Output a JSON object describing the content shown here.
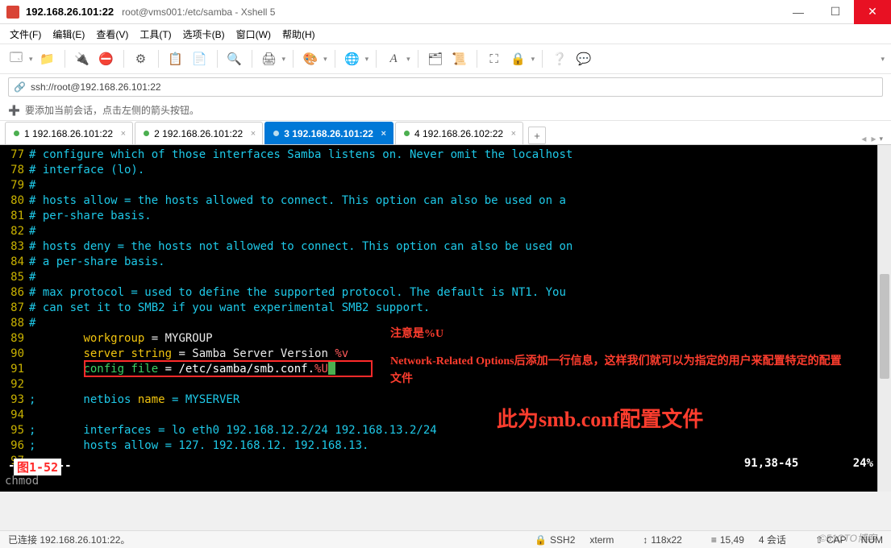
{
  "title": {
    "main": "192.168.26.101:22",
    "sub": "root@vms001:/etc/samba - Xshell 5"
  },
  "menu": {
    "file": "文件(F)",
    "edit": "编辑(E)",
    "view": "查看(V)",
    "tools": "工具(T)",
    "tabs": "选项卡(B)",
    "window": "窗口(W)",
    "help": "帮助(H)"
  },
  "address": {
    "text": "ssh://root@192.168.26.101:22"
  },
  "hint": {
    "text": "要添加当前会话，点击左侧的箭头按钮。"
  },
  "tabs": [
    {
      "label": "1 192.168.26.101:22",
      "active": false
    },
    {
      "label": "2 192.168.26.101:22",
      "active": false
    },
    {
      "label": "3 192.168.26.101:22",
      "active": true
    },
    {
      "label": "4 192.168.26.102:22",
      "active": false
    }
  ],
  "term": {
    "l77": {
      "n": "77",
      "t": "# configure which of those interfaces Samba listens on. Never omit the localhost"
    },
    "l78": {
      "n": "78",
      "t": "# interface (lo)."
    },
    "l79": {
      "n": "79",
      "t": "#"
    },
    "l80": {
      "n": "80",
      "t": "# hosts allow = the hosts allowed to connect. This option can also be used on a"
    },
    "l81": {
      "n": "81",
      "t": "# per-share basis."
    },
    "l82": {
      "n": "82",
      "t": "#"
    },
    "l83": {
      "n": "83",
      "t": "# hosts deny = the hosts not allowed to connect. This option can also be used on"
    },
    "l84": {
      "n": "84",
      "t": "# a per-share basis."
    },
    "l85": {
      "n": "85",
      "t": "#"
    },
    "l86": {
      "n": "86",
      "t": "# max protocol = used to define the supported protocol. The default is NT1. You"
    },
    "l87": {
      "n": "87",
      "t": "# can set it to SMB2 if you want experimental SMB2 support."
    },
    "l88": {
      "n": "88",
      "t": "#"
    },
    "l89": {
      "n": "89",
      "pre": "        ",
      "k": "workgroup",
      "v": " = MYGROUP"
    },
    "l90": {
      "n": "90",
      "pre": "        ",
      "k": "server string",
      "v": " = Samba Server Version ",
      "tail": "%v"
    },
    "l91": {
      "n": "91",
      "pre": "        ",
      "k": "config file",
      "v": " = /etc/samba/smb.conf.",
      "tail": "%U"
    },
    "l92": {
      "n": "92"
    },
    "l93": {
      "n": "93",
      "s": ";       netbios ",
      "k": "name",
      "v": " = MYSERVER"
    },
    "l94": {
      "n": "94"
    },
    "l95": {
      "n": "95",
      "s": ";       interfaces = lo eth0 192.168.12.2/24 192.168.13.2/24"
    },
    "l96": {
      "n": "96",
      "s": ";       hosts allow = 127. 192.168.12. 192.168.13."
    },
    "l97": {
      "n": "97"
    }
  },
  "status": {
    "mode": "-- 插入 --",
    "pos": "91,38-45        24%",
    "cmd": "chmod"
  },
  "anno": {
    "a1": "注意是%U",
    "a2": "Network-Related Options后添加一行信息，这样我们就可以为指定的用户来配置特定的配置文件",
    "a3": "此为smb.conf配置文件"
  },
  "figure": "图1-52",
  "bottom": {
    "conn": "已连接 192.168.26.101:22。",
    "proto": "SSH2",
    "term": "xterm",
    "size": "118x22",
    "rc": "15,49",
    "sess": "4 会话",
    "cap": "CAP",
    "num": "NUM"
  },
  "watermark": "©51CTO博客"
}
